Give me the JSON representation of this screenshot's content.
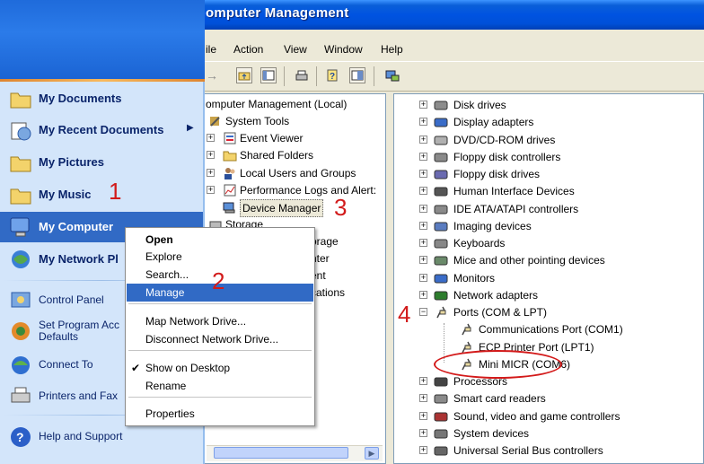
{
  "window": {
    "title": "omputer Management"
  },
  "menubar": [
    "ile",
    "Action",
    "View",
    "Window",
    "Help"
  ],
  "left_tree": [
    {
      "label": "omputer Management (Local)"
    },
    {
      "label": "System Tools"
    },
    {
      "label": "Event Viewer"
    },
    {
      "label": "Shared Folders"
    },
    {
      "label": "Local Users and Groups"
    },
    {
      "label": "Performance Logs and Alert:"
    },
    {
      "label": "Device Manager"
    },
    {
      "label": "Storage"
    },
    {
      "label": "orage"
    },
    {
      "label": "nter"
    },
    {
      "label": "ent"
    },
    {
      "label": "cations"
    }
  ],
  "devices": [
    {
      "label": "Disk drives",
      "expand": "+"
    },
    {
      "label": "Display adapters",
      "expand": "+"
    },
    {
      "label": "DVD/CD-ROM drives",
      "expand": "+"
    },
    {
      "label": "Floppy disk controllers",
      "expand": "+"
    },
    {
      "label": "Floppy disk drives",
      "expand": "+"
    },
    {
      "label": "Human Interface Devices",
      "expand": "+"
    },
    {
      "label": "IDE ATA/ATAPI controllers",
      "expand": "+"
    },
    {
      "label": "Imaging devices",
      "expand": "+"
    },
    {
      "label": "Keyboards",
      "expand": "+"
    },
    {
      "label": "Mice and other pointing devices",
      "expand": "+"
    },
    {
      "label": "Monitors",
      "expand": "+"
    },
    {
      "label": "Network adapters",
      "expand": "+"
    },
    {
      "label": "Ports (COM & LPT)",
      "expand": "-"
    },
    {
      "label": "Communications Port (COM1)",
      "expand": ""
    },
    {
      "label": "ECP Printer Port (LPT1)",
      "expand": ""
    },
    {
      "label": "Mini MICR (COM6)",
      "expand": ""
    },
    {
      "label": "Processors",
      "expand": "+"
    },
    {
      "label": "Smart card readers",
      "expand": "+"
    },
    {
      "label": "Sound, video and game controllers",
      "expand": "+"
    },
    {
      "label": "System devices",
      "expand": "+"
    },
    {
      "label": "Universal Serial Bus controllers",
      "expand": "+"
    }
  ],
  "start_menu": {
    "items": [
      {
        "label": "My Documents",
        "icon": "folder-documents-icon"
      },
      {
        "label": "My Recent Documents",
        "icon": "recent-documents-icon"
      },
      {
        "label": "My Pictures",
        "icon": "folder-pictures-icon"
      },
      {
        "label": "My Music",
        "icon": "folder-music-icon"
      },
      {
        "label": "My Computer",
        "icon": "computer-icon"
      },
      {
        "label": "My Network Pl",
        "icon": "network-places-icon"
      }
    ],
    "secondary": [
      {
        "label": "Control Panel",
        "icon": "control-panel-icon"
      },
      {
        "label": "Set Program Acc\nDefaults",
        "icon": "program-defaults-icon"
      },
      {
        "label": "Connect To",
        "icon": "connect-to-icon"
      },
      {
        "label": "Printers and Fax",
        "icon": "printers-icon"
      },
      {
        "label": "Help and Support",
        "icon": "help-icon"
      }
    ]
  },
  "context_menu": {
    "items": [
      {
        "label": "Open",
        "bold": true
      },
      {
        "label": "Explore"
      },
      {
        "label": "Search..."
      },
      {
        "label": "Manage",
        "highlighted": true
      },
      {
        "label": "Map Network Drive..."
      },
      {
        "label": "Disconnect Network Drive..."
      },
      {
        "label": "Show on Desktop",
        "checked": true
      },
      {
        "label": "Rename"
      },
      {
        "label": "Properties"
      }
    ]
  },
  "annotations": {
    "step1": "1",
    "step2": "2",
    "step3": "3",
    "step4": "4"
  },
  "colors": {
    "accent_red": "#d21b1b",
    "xp_blue": "#316ac5",
    "start_panel": "#d3e5fa"
  }
}
